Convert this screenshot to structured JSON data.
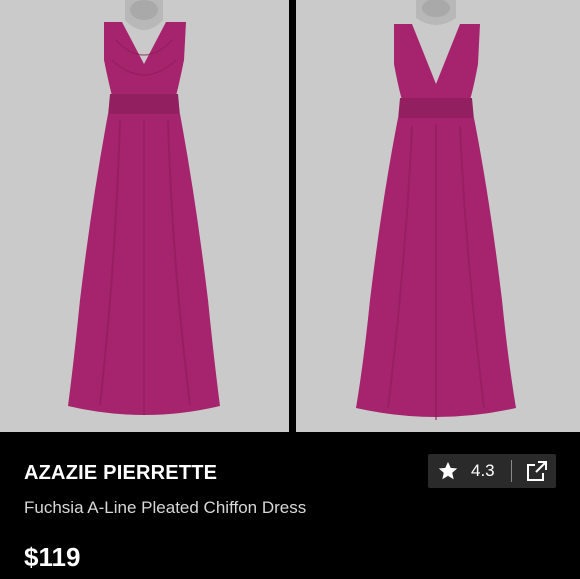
{
  "product": {
    "brand": "AZAZIE PIERRETTE",
    "title": "Fuchsia A-Line Pleated Chiffon Dress",
    "price": "$119",
    "rating": "4.3"
  },
  "images": [
    {
      "icon": "dress-front-photo"
    },
    {
      "icon": "dress-back-photo"
    }
  ],
  "colors": {
    "dress": "#a6246e",
    "photo_background": "#c9c9c9",
    "page_background": "#000000"
  }
}
